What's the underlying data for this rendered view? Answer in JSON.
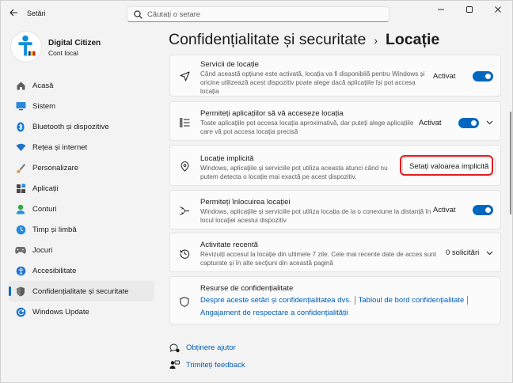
{
  "window": {
    "app_title": "Setări"
  },
  "search": {
    "placeholder": "Căutați o setare"
  },
  "profile": {
    "name": "Digital Citizen",
    "account": "Cont local"
  },
  "sidebar": {
    "items": [
      {
        "label": "Acasă",
        "icon": "home-icon"
      },
      {
        "label": "Sistem",
        "icon": "system-icon"
      },
      {
        "label": "Bluetooth și dispozitive",
        "icon": "bluetooth-icon"
      },
      {
        "label": "Rețea și internet",
        "icon": "wifi-icon"
      },
      {
        "label": "Personalizare",
        "icon": "brush-icon"
      },
      {
        "label": "Aplicații",
        "icon": "apps-icon"
      },
      {
        "label": "Conturi",
        "icon": "person-icon"
      },
      {
        "label": "Timp și limbă",
        "icon": "clock-globe-icon"
      },
      {
        "label": "Jocuri",
        "icon": "gamepad-icon"
      },
      {
        "label": "Accesibilitate",
        "icon": "accessibility-icon"
      },
      {
        "label": "Confidențialitate și securitate",
        "icon": "shield-icon",
        "active": true
      },
      {
        "label": "Windows Update",
        "icon": "update-icon"
      }
    ]
  },
  "header": {
    "parent": "Confidențialitate și securitate",
    "separator": "›",
    "current": "Locație"
  },
  "cards": {
    "location_services": {
      "title": "Servicii de locație",
      "desc": "Când această opțiune este activată, locația va fi disponibilă pentru Windows și oricine utilizează acest dispozitiv poate alege dacă aplicațiile își pot accesa locația",
      "state": "Activat",
      "on": true
    },
    "app_access": {
      "title": "Permiteți aplicațiilor să vă acceseze locația",
      "desc": "Toate aplicațiile pot accesa locația aproximativă, dar puteți alege aplicațiile care vă pot accesa locația precisă",
      "state": "Activat",
      "on": true
    },
    "default_location": {
      "title": "Locație implicită",
      "desc": "Windows, aplicațiile și serviciile pot utiliza aceasta atunci când nu putem detecta o locație mai exactă pe acest dispozitiv.",
      "button": "Setați valoarea implicită"
    },
    "override": {
      "title": "Permiteți înlocuirea locației",
      "desc": "Windows, aplicațiile și serviciile pot utiliza locația de la o conexiune la distanță în locul locației acestui dispozitiv",
      "state": "Activat",
      "on": true
    },
    "recent_activity": {
      "title": "Activitate recentă",
      "desc": "Revizuiți accesul la locație din ultimele 7 zile. Cele mai recente date de acces sunt capturate și în alte secțiuni din această pagină",
      "count": "0 solicitări"
    },
    "resources": {
      "title": "Resurse de confidențialitate",
      "link1": "Despre aceste setări și confidențialitatea dvs.",
      "link2": "Tabloul de bord confidențialitate",
      "link3": "Angajament de respectare a confidențialității"
    }
  },
  "footer": {
    "help": "Obținere ajutor",
    "feedback": "Trimiteți feedback"
  },
  "colors": {
    "accent": "#0067c0",
    "highlight": "#e01e1e"
  }
}
